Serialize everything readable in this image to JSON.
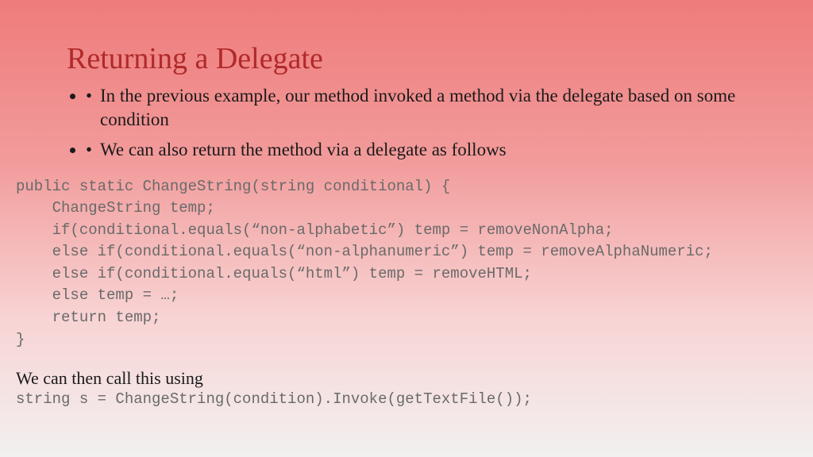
{
  "title": "Returning a Delegate",
  "bullets": [
    "In the previous example, our method invoked a method via the delegate based on some condition",
    "We can also return the method via a delegate as follows"
  ],
  "code": "public static ChangeString(string conditional) {\n    ChangeString temp;\n    if(conditional.equals(“non-alphabetic”) temp = removeNonAlpha;\n    else if(conditional.equals(“non-alphanumeric”) temp = removeAlphaNumeric;\n    else if(conditional.equals(“html”) temp = removeHTML;\n    else temp = …;\n    return temp;\n}",
  "caption": "We can then call this using",
  "code2": "string s = ChangeString(condition).Invoke(getTextFile());"
}
